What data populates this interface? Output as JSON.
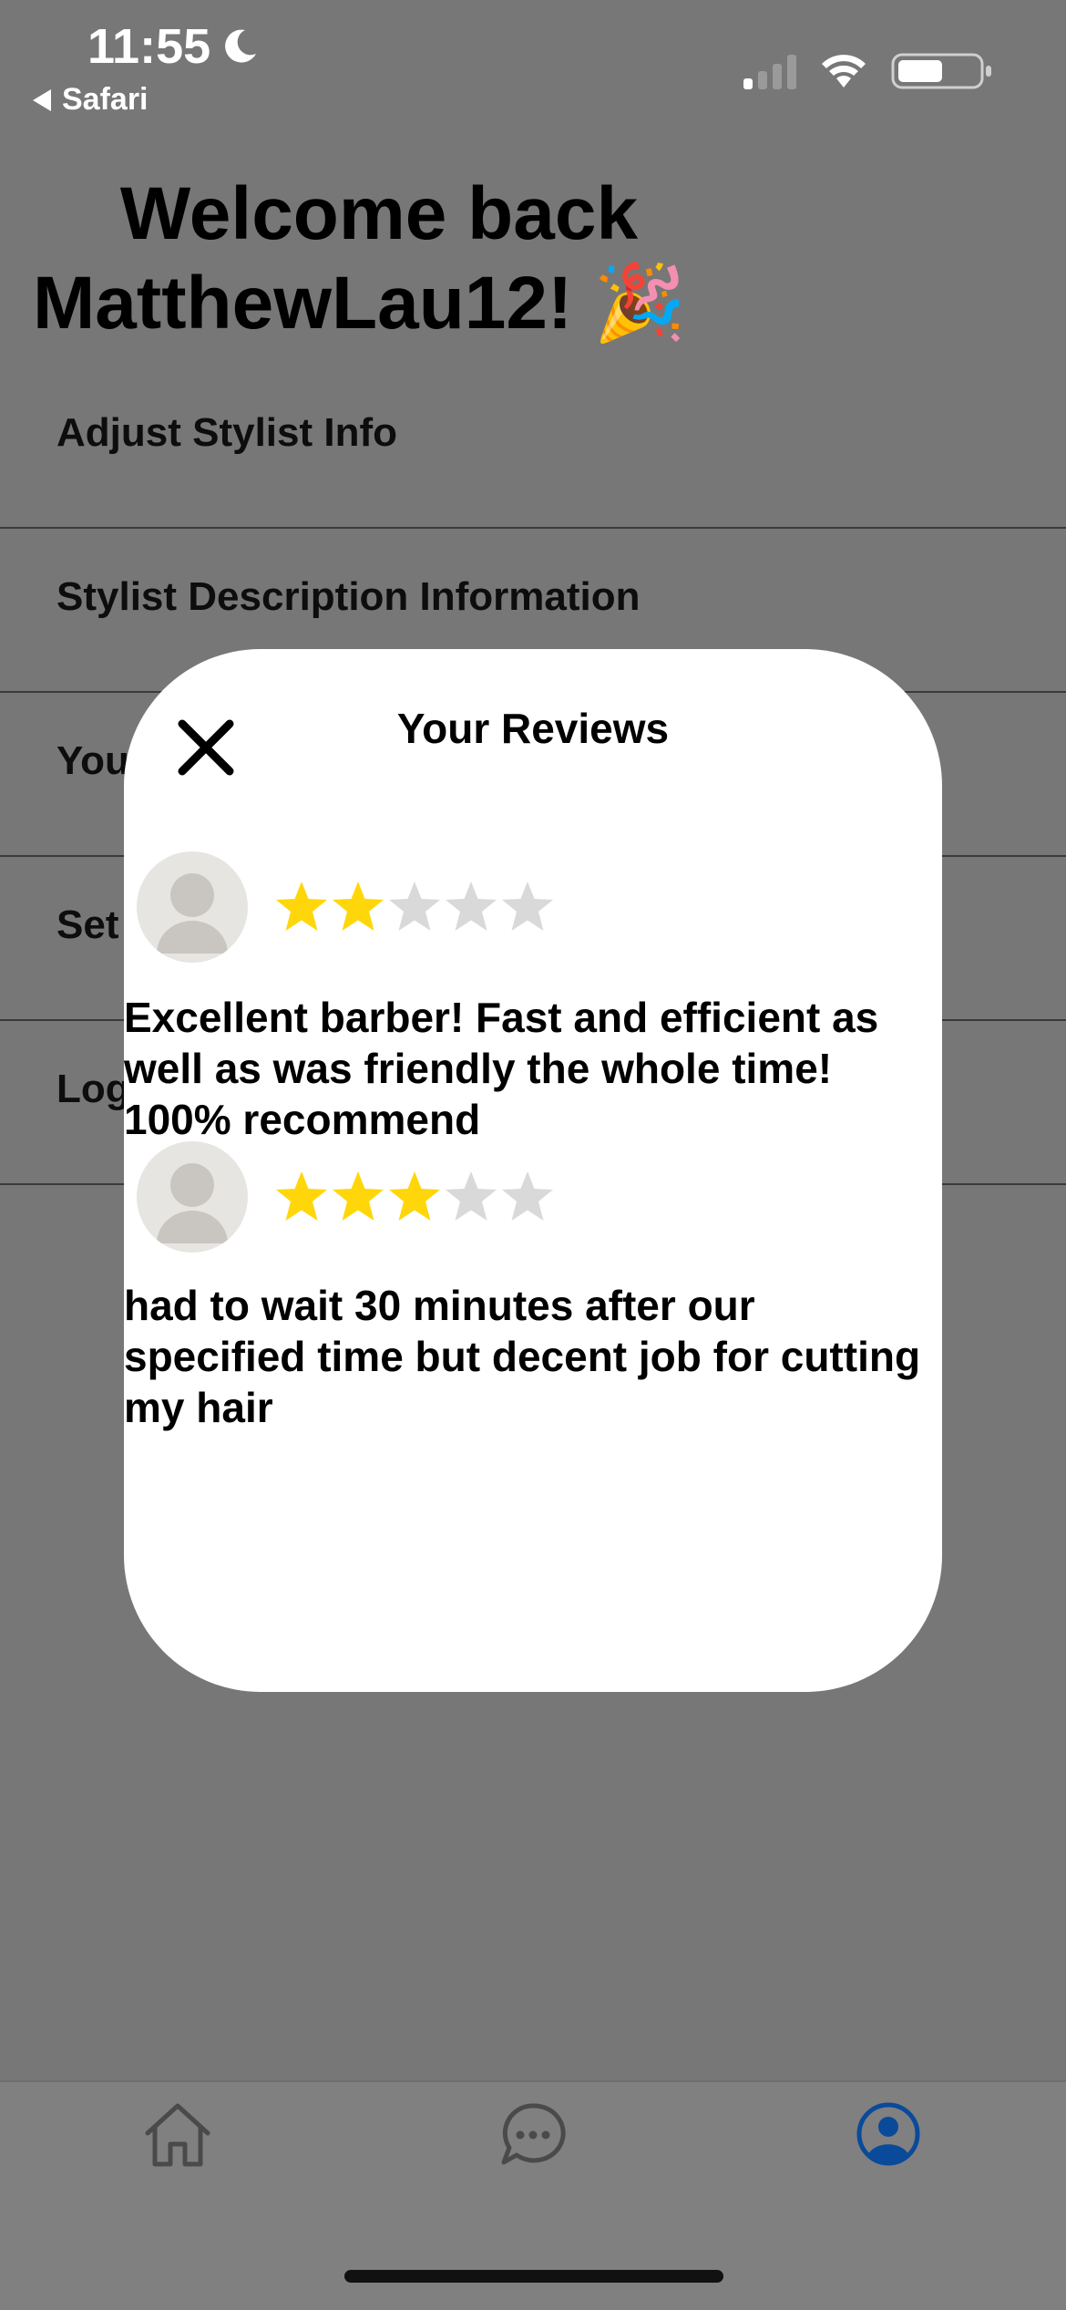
{
  "status_bar": {
    "time": "11:55",
    "back_label": "Safari"
  },
  "welcome": {
    "line1": "Welcome back",
    "line2": "MatthewLau12! 🎉"
  },
  "menu": {
    "items": [
      {
        "label": "Adjust Stylist Info"
      },
      {
        "label": "Stylist Description Information"
      },
      {
        "label": "You"
      },
      {
        "label": "Set"
      },
      {
        "label": "Log"
      }
    ]
  },
  "modal": {
    "title": "Your Reviews",
    "reviews": [
      {
        "rating": 2,
        "max": 5,
        "text": "Excellent barber! Fast and efficient as well as was friendly the whole time! 100% recommend"
      },
      {
        "rating": 3,
        "max": 5,
        "text": "had to wait 30 minutes after our specified time but decent job for cutting my hair"
      }
    ]
  },
  "tabbar": {
    "icons": [
      "home-icon",
      "chat-icon",
      "profile-icon"
    ],
    "active": "profile-icon"
  },
  "colors": {
    "overlay": "#777777",
    "star_filled": "#FFD60A",
    "star_empty": "#D9D9D9",
    "active_tab": "#0A4A9A"
  }
}
